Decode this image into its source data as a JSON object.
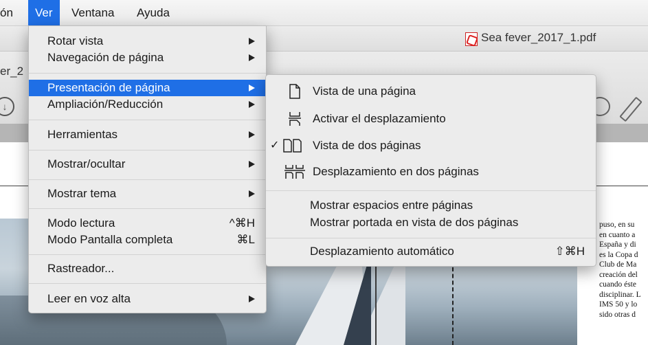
{
  "menubar": {
    "prev_label": "ón",
    "ver": "Ver",
    "ventana": "Ventana",
    "ayuda": "Ayuda"
  },
  "window": {
    "doc_title": "Sea fever_2017_1.pdf",
    "tab_fragment": "er_2"
  },
  "ver_menu": {
    "items": [
      {
        "label": "Rotar vista"
      },
      {
        "label": "Navegación de página"
      },
      {
        "label": "Presentación de página"
      },
      {
        "label": "Ampliación/Reducción"
      },
      {
        "label": "Herramientas"
      },
      {
        "label": "Mostrar/ocultar"
      },
      {
        "label": "Mostrar tema"
      },
      {
        "label": "Modo lectura",
        "shortcut": "^⌘H"
      },
      {
        "label": "Modo Pantalla completa",
        "shortcut": "⌘L"
      },
      {
        "label": "Rastreador..."
      },
      {
        "label": "Leer en voz alta"
      }
    ]
  },
  "layout_submenu": {
    "items": [
      {
        "label": "Vista de una página",
        "icon": "single-page-icon"
      },
      {
        "label": "Activar el desplazamiento",
        "icon": "scrolling-icon"
      },
      {
        "label": "Vista de dos páginas",
        "icon": "two-page-icon",
        "checked": true,
        "check_mark": "✓"
      },
      {
        "label": "Desplazamiento en dos páginas",
        "icon": "two-page-scroll-icon"
      },
      {
        "label": "Mostrar espacios entre páginas"
      },
      {
        "label": "Mostrar portada en vista de dos páginas"
      },
      {
        "label": "Desplazamiento automático",
        "shortcut": "⇧⌘H"
      }
    ]
  },
  "article_lines": [
    "puso, en su",
    "en cuanto a",
    "España y di",
    "es la Copa d",
    "Club de Ma",
    "creación del",
    "cuando éste",
    "disciplinar. L",
    "IMS 50 y lo",
    "sido otras d"
  ],
  "colors": {
    "highlight": "#1f6fe6",
    "menu_bg": "#ececec"
  }
}
